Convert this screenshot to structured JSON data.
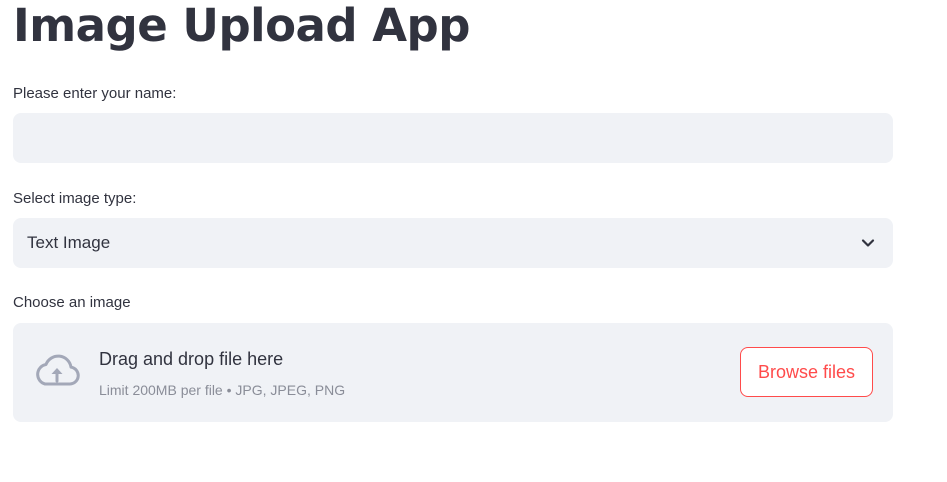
{
  "app": {
    "title": "Image Upload App"
  },
  "name_field": {
    "label": "Please enter your name:",
    "value": "",
    "placeholder": ""
  },
  "image_type": {
    "label": "Select image type:",
    "selected": "Text Image",
    "icon": "chevron-down-icon"
  },
  "uploader": {
    "label": "Choose an image",
    "drop_text": "Drag and drop file here",
    "limit_text": "Limit 200MB per file • JPG, JPEG, PNG",
    "browse_label": "Browse files",
    "icon": "cloud-upload-icon"
  },
  "colors": {
    "accent": "#ff4b4b",
    "text": "#31333f",
    "field_background": "#f0f2f6",
    "muted_text": "#8a8d98",
    "icon": "#a3a8b8"
  }
}
